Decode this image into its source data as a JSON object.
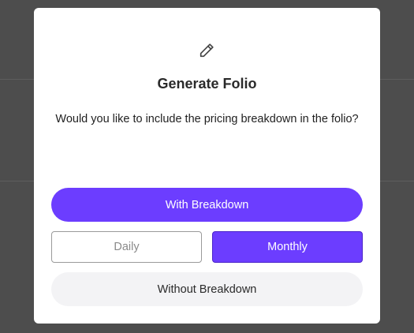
{
  "modal": {
    "icon": "pencil-icon",
    "title": "Generate Folio",
    "message": "Would you like to include the pricing breakdown in the folio?"
  },
  "buttons": {
    "with_breakdown": "With Breakdown",
    "daily": "Daily",
    "monthly": "Monthly",
    "without_breakdown": "Without Breakdown"
  },
  "state": {
    "selected_period": "Monthly"
  },
  "colors": {
    "accent": "#6c3dff",
    "backdrop": "#4d4d4d",
    "secondary_button": "#f3f3f5"
  }
}
